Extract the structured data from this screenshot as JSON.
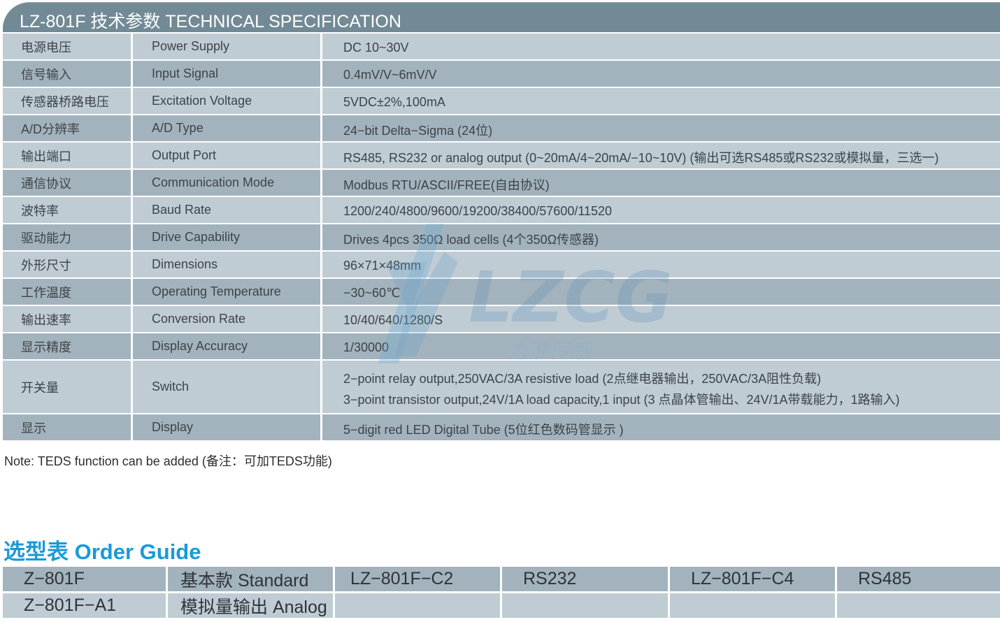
{
  "spec": {
    "title": "LZ-801F 技术参数 TECHNICAL SPECIFICATION",
    "rows": [
      {
        "cn": "电源电压",
        "en": "Power Supply",
        "value": "DC 10~30V"
      },
      {
        "cn": "信号输入",
        "en": "Input Signal",
        "value": "0.4mV/V~6mV/V"
      },
      {
        "cn": "传感器桥路电压",
        "en": "Excitation Voltage",
        "value": "5VDC±2%,100mA"
      },
      {
        "cn": "A/D分辨率",
        "en": "A/D Type",
        "value": "24−bit Delta−Sigma (24位)"
      },
      {
        "cn": "输出端口",
        "en": "Output Port",
        "value": "RS485, RS232 or analog output (0~20mA/4~20mA/−10~10V) (输出可选RS485或RS232或模拟量，三选一)"
      },
      {
        "cn": "通信协议",
        "en": "Communication Mode",
        "value": "Modbus RTU/ASCII/FREE(自由协议)"
      },
      {
        "cn": "波特率",
        "en": "Baud Rate",
        "value": "1200/240/4800/9600/19200/38400/57600/11520"
      },
      {
        "cn": "驱动能力",
        "en": "Drive Capability",
        "value": "Drives 4pcs 350Ω load cells (4个350Ω传感器)"
      },
      {
        "cn": "外形尺寸",
        "en": "Dimensions",
        "value": "96×71×48mm"
      },
      {
        "cn": "工作温度",
        "en": "Operating Temperature",
        "value": "−30~60℃"
      },
      {
        "cn": "输出速率",
        "en": "Conversion Rate",
        "value": "10/40/640/1280/S"
      },
      {
        "cn": "显示精度",
        "en": "Display Accuracy",
        "value": "1/30000"
      },
      {
        "cn": "开关量",
        "en": "Switch",
        "value_lines": [
          "2−point relay output,250VAC/3A resistive load (2点继电器输出，250VAC/3A阻性负载)",
          "3−point transistor output,24V/1A load capacity,1 input (3 点晶体管输出、24V/1A带载能力，1路输入)"
        ]
      },
      {
        "cn": "显示",
        "en": "Display",
        "value": "5−digit red LED Digital Tube (5位红色数码管显示 )"
      }
    ]
  },
  "note": "Note: TEDS function can be added (备注：可加TEDS功能)",
  "watermark": {
    "brand": "LZCG",
    "cn": "力准传感",
    "color": "#5fa3cf"
  },
  "order_guide": {
    "title": "选型表 Order Guide",
    "rows": [
      [
        "Z−801F",
        "基本款 Standard",
        "LZ−801F−C2",
        "RS232",
        "LZ−801F−C4",
        "RS485"
      ],
      [
        "Z−801F−A1",
        "模拟量输出 Analog",
        "",
        "",
        "",
        ""
      ]
    ]
  },
  "colors": {
    "header_bg": "#728a96",
    "row_light": "#bfccd4",
    "row_dark": "#a3b3bd",
    "order_title": "#1a9ad8"
  }
}
